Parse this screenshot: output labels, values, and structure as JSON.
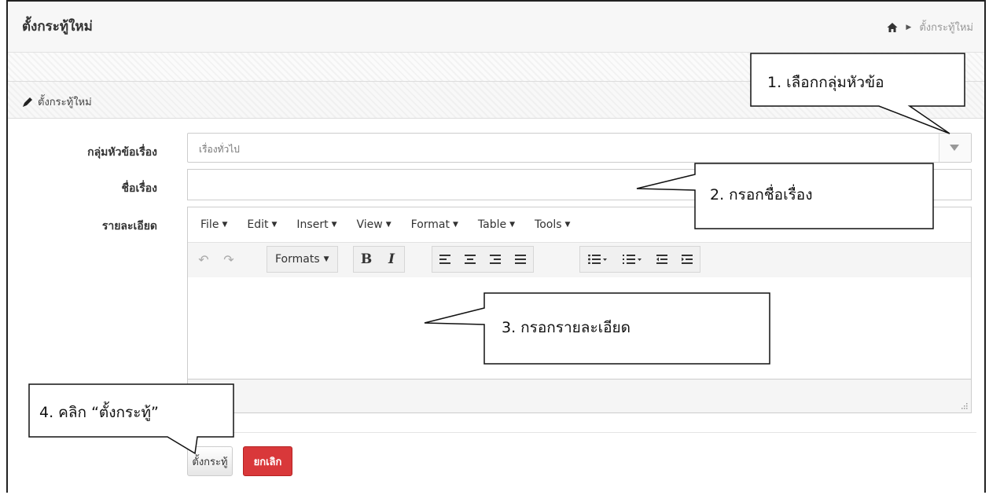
{
  "header": {
    "title": "ตั้งกระทู้ใหม่",
    "breadcrumb": {
      "current": "ตั้งกระทู้ใหม่"
    }
  },
  "panel": {
    "title": "ตั้งกระทู้ใหม่"
  },
  "form": {
    "category_label": "กลุ่มหัวข้อเรื่อง",
    "category_value": "เรื่องทั่วไป",
    "subject_label": "ชื่อเรื่อง",
    "subject_value": "",
    "detail_label": "รายละเอียด"
  },
  "editor": {
    "menu": [
      "File",
      "Edit",
      "Insert",
      "View",
      "Format",
      "Table",
      "Tools"
    ],
    "toolbar": {
      "formats_label": "Formats",
      "bold": "B",
      "italic": "I"
    }
  },
  "buttons": {
    "submit": "ตั้งกระทู้",
    "cancel": "ยกเลิก"
  },
  "annotations": [
    "1. เลือกกลุ่มหัวข้อ",
    "2. กรอกชื่อเรื่อง",
    "3. กรอกรายละเอียด",
    "4. คลิก  “ตั้งกระทู้”"
  ],
  "colors": {
    "cancel_button": "#d9383a",
    "header_bg": "#f7f7f7"
  }
}
